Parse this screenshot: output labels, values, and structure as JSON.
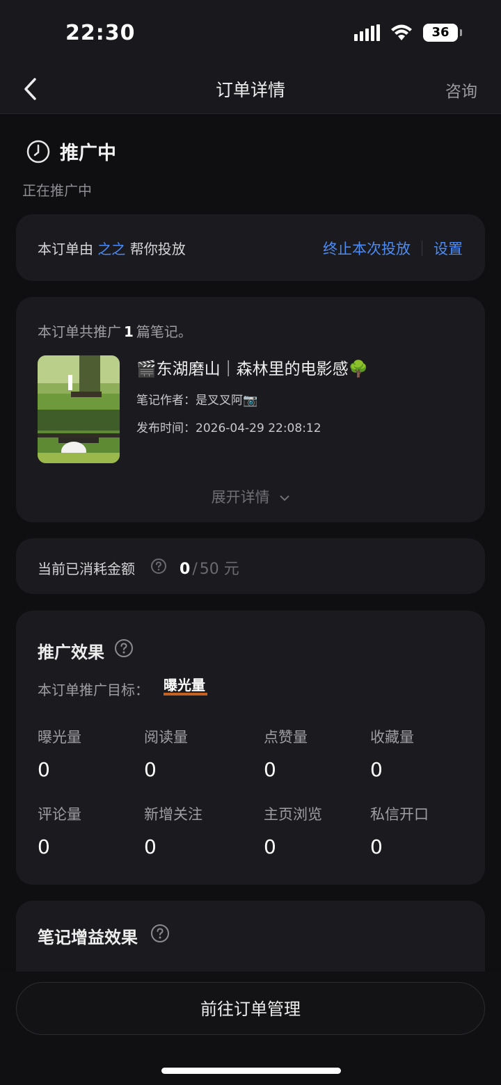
{
  "status_bar": {
    "time": "22:30",
    "battery": "36"
  },
  "nav": {
    "title": "订单详情",
    "consult": "咨询"
  },
  "promo_status": {
    "title": "推广中",
    "subtitle": "正在推广中"
  },
  "agent": {
    "prefix": "本订单由",
    "name": "之之",
    "suffix": "帮你投放",
    "stop_label": "终止本次投放",
    "settings_label": "设置"
  },
  "note_card": {
    "count_prefix": "本订单共推广",
    "count": "1",
    "count_suffix": "篇笔记。",
    "note_title": "🎬东湖磨山｜森林里的电影感🌳",
    "author": "笔记作者：是叉叉阿📷",
    "publish_time": "发布时间：2026-04-29 22:08:12",
    "expand_label": "展开详情"
  },
  "spent": {
    "label": "当前已消耗金额",
    "current": "0",
    "separator": "/",
    "total": "50 元"
  },
  "effect": {
    "title": "推广效果",
    "goal_label": "本订单推广目标：",
    "goal_value": "曝光量",
    "metrics": [
      {
        "label": "曝光量",
        "value": "0"
      },
      {
        "label": "阅读量",
        "value": "0"
      },
      {
        "label": "点赞量",
        "value": "0"
      },
      {
        "label": "收藏量",
        "value": "0"
      },
      {
        "label": "评论量",
        "value": "0"
      },
      {
        "label": "新增关注",
        "value": "0"
      },
      {
        "label": "主页浏览",
        "value": "0"
      },
      {
        "label": "私信开口",
        "value": "0"
      }
    ]
  },
  "gain": {
    "title": "笔记增益效果"
  },
  "bottom": {
    "manage_button": "前往订单管理"
  }
}
